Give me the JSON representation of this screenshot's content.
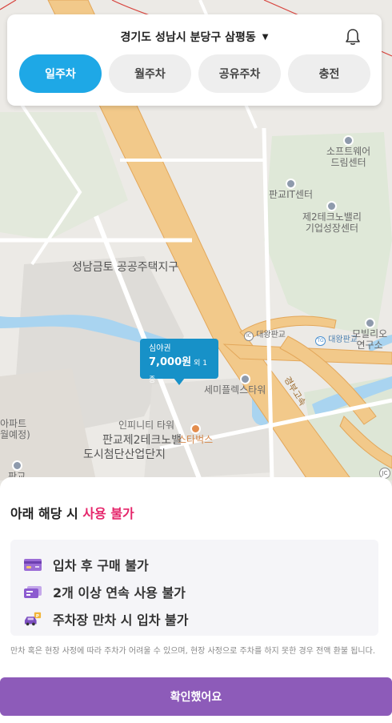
{
  "header": {
    "location": "경기도 성남시 분당구 삼평동",
    "tabs": [
      "일주차",
      "월주차",
      "공유주차",
      "충전"
    ],
    "active_tab": 0
  },
  "map": {
    "labels": {
      "softwaredream": "소프트웨어\n드림센터",
      "pangyo_it": "판교IT센터",
      "techno2": "제2테크노밸리\n기업성장센터",
      "seongnam": "성남금토\n공공주택지구",
      "daewang_ic": "대왕판교",
      "daewang_tg": "대왕판교",
      "mobility": "모빌리오\n연구소",
      "gyeongbu": "경부고속",
      "semi": "세미플렉스타워",
      "infinity": "인피니티\n타워",
      "starbucks": "스타벅스",
      "pangyo_valley": "판교제2테크노밸",
      "urban_industry": "도시첨단산업단지",
      "apartment": "아파트\n월예정)",
      "pangyo_bottom": "판교",
      "ic_badge": "IC",
      "tg_badge": "TG",
      "jc_badge": "JC"
    },
    "marker": {
      "title": "심야권",
      "price": "7,000원",
      "extra": "외 1종"
    }
  },
  "sheet": {
    "title_prefix": "아래 해당 시 ",
    "title_accent": "사용 불가",
    "rules": [
      {
        "icon": "card-icon",
        "text": "입차 후 구매 불가"
      },
      {
        "icon": "ticket-icon",
        "text": "2개 이상 연속 사용 불가"
      },
      {
        "icon": "car-parking-icon",
        "text": "주차장 만차 시 입차 불가"
      }
    ],
    "note": "만차 혹은 현장 사정에 따라 주차가 어려울 수 있으며, 현장 사정으로 주차를 하지 못한 경우 전액 환불 됩니다.",
    "confirm_label": "확인했어요"
  },
  "colors": {
    "tab_active": "#1ea8e6",
    "marker": "#1791c8",
    "accent": "#e5266b",
    "confirm": "#8d5bb9"
  }
}
